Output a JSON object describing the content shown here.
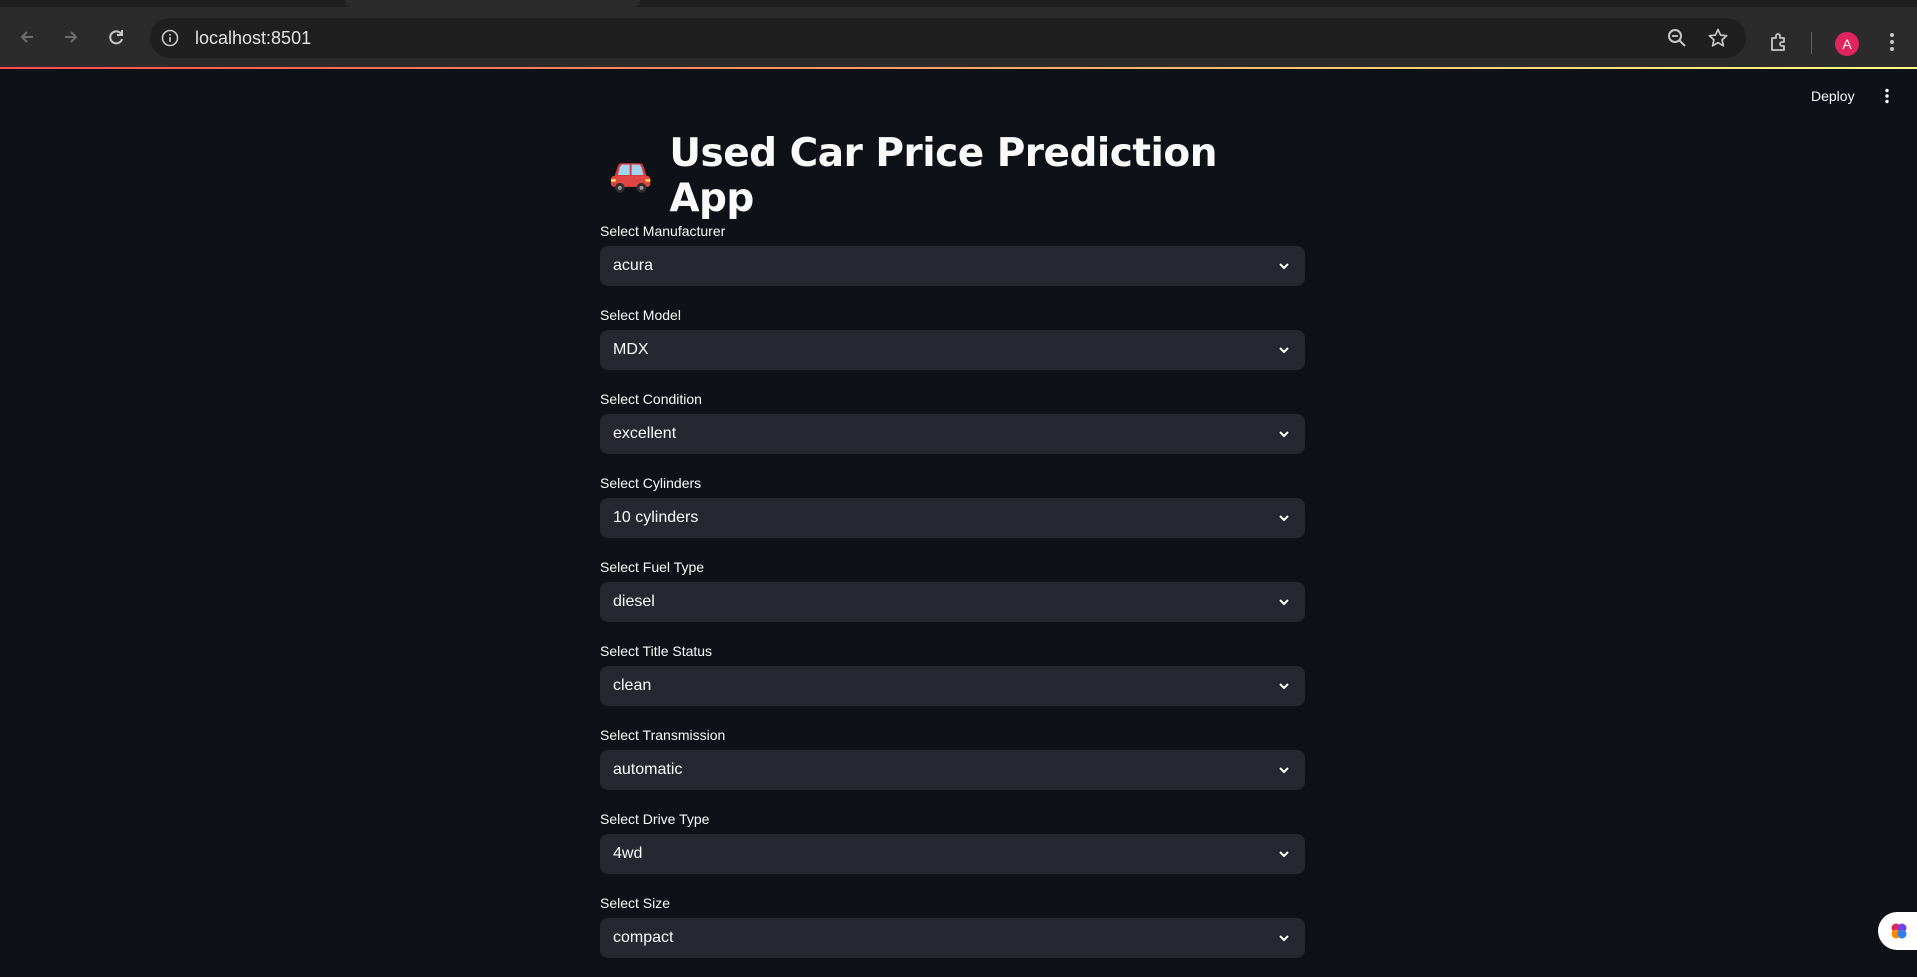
{
  "browser": {
    "url": "localhost:8501",
    "avatar_letter": "A"
  },
  "header": {
    "deploy_label": "Deploy"
  },
  "app": {
    "title_emoji": "🚗",
    "title": "Used Car Price Prediction App"
  },
  "fields": [
    {
      "label": "Select Manufacturer",
      "value": "acura"
    },
    {
      "label": "Select Model",
      "value": "MDX"
    },
    {
      "label": "Select Condition",
      "value": "excellent"
    },
    {
      "label": "Select Cylinders",
      "value": "10 cylinders"
    },
    {
      "label": "Select Fuel Type",
      "value": "diesel"
    },
    {
      "label": "Select Title Status",
      "value": "clean"
    },
    {
      "label": "Select Transmission",
      "value": "automatic"
    },
    {
      "label": "Select Drive Type",
      "value": "4wd"
    },
    {
      "label": "Select Size",
      "value": "compact"
    }
  ],
  "colors": {
    "background": "#0e1117",
    "select_bg": "#262730",
    "accent_red": "#ff4b4b",
    "accent_yellow": "#fffd80",
    "avatar": "#e0245e"
  },
  "icons": [
    "back-arrow-icon",
    "forward-arrow-icon",
    "reload-icon",
    "site-info-icon",
    "zoom-icon",
    "bookmark-star-icon",
    "extensions-icon",
    "chrome-menu-icon",
    "kebab-menu-icon",
    "chevron-down-icon",
    "car-icon",
    "brain-icon"
  ]
}
